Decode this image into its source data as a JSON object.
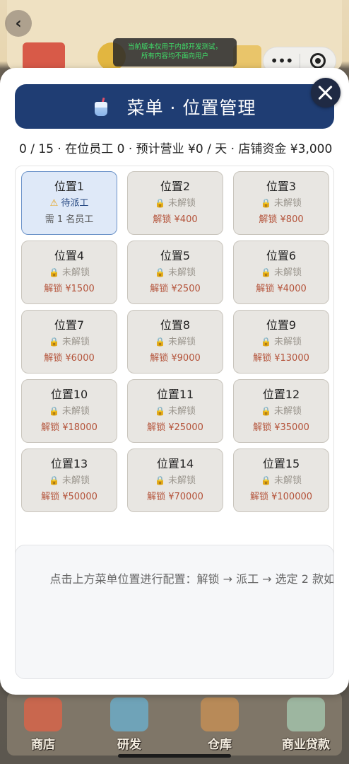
{
  "app": {
    "dev_notice_line1": "当前版本仅用于内部开发测试，",
    "dev_notice_line2": "所有内容均不面向用户",
    "back_icon": "back-arrow-icon",
    "capsule_more": "•••",
    "capsule_icons": [
      "more-icon",
      "target-icon"
    ]
  },
  "modal": {
    "title": "菜单 · 位置管理",
    "title_icon": "drink-cup-icon",
    "header_color": "#1f3d73",
    "close_icon": "close-icon",
    "status_line": "0 / 15 · 在位员工 0 · 预计营业 ¥0 / 天 · 店铺资金 ¥3,000",
    "slots": [
      {
        "name": "位置1",
        "state": "待派工",
        "detail": "需 1 名员工",
        "locked": false
      },
      {
        "name": "位置2",
        "state": "未解锁",
        "detail": "解锁 ¥400",
        "locked": true
      },
      {
        "name": "位置3",
        "state": "未解锁",
        "detail": "解锁 ¥800",
        "locked": true
      },
      {
        "name": "位置4",
        "state": "未解锁",
        "detail": "解锁 ¥1500",
        "locked": true
      },
      {
        "name": "位置5",
        "state": "未解锁",
        "detail": "解锁 ¥2500",
        "locked": true
      },
      {
        "name": "位置6",
        "state": "未解锁",
        "detail": "解锁 ¥4000",
        "locked": true
      },
      {
        "name": "位置7",
        "state": "未解锁",
        "detail": "解锁 ¥6000",
        "locked": true
      },
      {
        "name": "位置8",
        "state": "未解锁",
        "detail": "解锁 ¥9000",
        "locked": true
      },
      {
        "name": "位置9",
        "state": "未解锁",
        "detail": "解锁 ¥13000",
        "locked": true
      },
      {
        "name": "位置10",
        "state": "未解锁",
        "detail": "解锁 ¥18000",
        "locked": true
      },
      {
        "name": "位置11",
        "state": "未解锁",
        "detail": "解锁 ¥25000",
        "locked": true
      },
      {
        "name": "位置12",
        "state": "未解锁",
        "detail": "解锁 ¥35000",
        "locked": true
      },
      {
        "name": "位置13",
        "state": "未解锁",
        "detail": "解锁 ¥50000",
        "locked": true
      },
      {
        "name": "位置14",
        "state": "未解锁",
        "detail": "解锁 ¥70000",
        "locked": true
      },
      {
        "name": "位置15",
        "state": "未解锁",
        "detail": "解锁 ¥100000",
        "locked": true
      }
    ],
    "hint": "点击上方菜单位置进行配置：解锁 → 派工 → 选定 2 款如"
  },
  "bottom_nav": [
    {
      "label": "商店",
      "icon": "shop-icon"
    },
    {
      "label": "研发",
      "icon": "research-flask-icon"
    },
    {
      "label": "仓库",
      "icon": "warehouse-boxes-icon"
    },
    {
      "label": "商业贷款",
      "icon": "handshake-loan-icon"
    }
  ]
}
